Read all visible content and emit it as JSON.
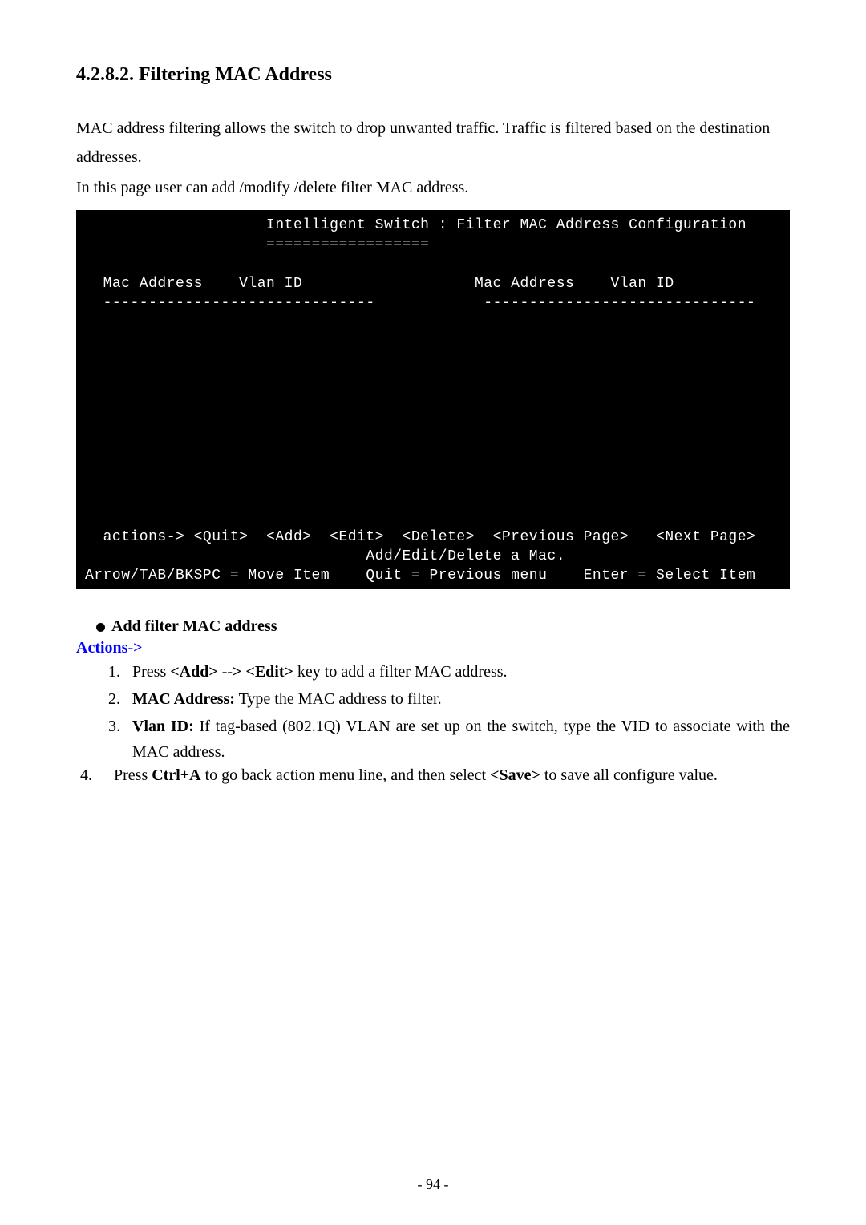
{
  "section": {
    "title": "4.2.8.2. Filtering MAC Address"
  },
  "intro": {
    "line1": "MAC address filtering allows the switch to drop unwanted traffic. Traffic is filtered based on the destination addresses.",
    "line2": "In this page user can add /modify /delete filter MAC address."
  },
  "terminal": {
    "content": "                    Intelligent Switch : Filter MAC Address Configuration\n                    ==================\n\n  Mac Address    Vlan ID                   Mac Address    Vlan ID\n  ------------------------------            ------------------------------\n\n\n\n\n\n\n\n\n\n\n\n  actions-> <Quit>  <Add>  <Edit>  <Delete>  <Previous Page>   <Next Page>\n                               Add/Edit/Delete a Mac.\nArrow/TAB/BKSPC = Move Item    Quit = Previous menu    Enter = Select Item"
  },
  "bullet": {
    "title": "Add filter MAC address"
  },
  "actionsLabel": "Actions->",
  "steps": {
    "s1a": "Press ",
    "s1b": "<Add> --> <Edit>",
    "s1c": " key to add a filter MAC address.",
    "s2a": "MAC Address:",
    "s2b": " Type the MAC address to filter.",
    "s3a": "Vlan ID:",
    "s3b": " If tag-based (802.1Q) VLAN are set up on the switch, type the VID to associate with the MAC address.",
    "s4num": "4.",
    "s4a": "Press ",
    "s4b": "Ctrl+A",
    "s4c": " to go back action menu line, and then select ",
    "s4d": "<Save>",
    "s4e": " to save all configure value."
  },
  "footer": "- 94 -"
}
